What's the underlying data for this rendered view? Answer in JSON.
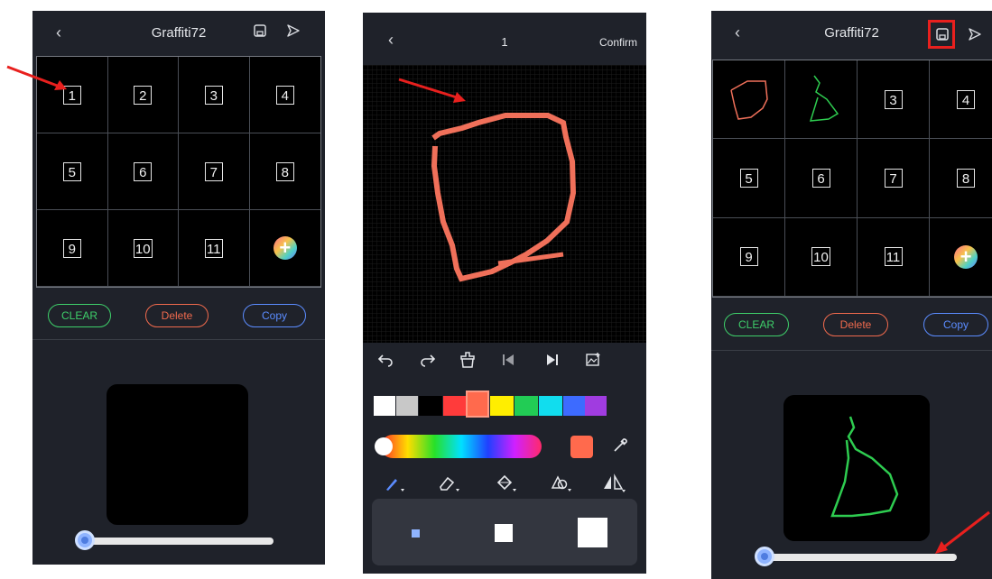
{
  "screens": [
    {
      "title": "Graffiti72",
      "back_icon": "‹",
      "cells": [
        "1",
        "2",
        "3",
        "4",
        "5",
        "6",
        "7",
        "8",
        "9",
        "10",
        "11"
      ],
      "buttons": {
        "clear": "CLEAR",
        "delete": "Delete",
        "copy": "Copy"
      }
    },
    {
      "title": "1",
      "back_icon": "‹",
      "confirm": "Confirm",
      "palette": [
        "#ffffff",
        "#c8c8c8",
        "#000000",
        "#ff3b3b",
        "#ff6a4d",
        "#ffee00",
        "#22cc55",
        "#11ddee",
        "#3d6bff",
        "#a03ce0"
      ],
      "current_color": "#ff6a4d",
      "brush_sizes": [
        "small",
        "medium",
        "large"
      ]
    },
    {
      "title": "Graffiti72",
      "back_icon": "‹",
      "cells": [
        "",
        "",
        "3",
        "4",
        "5",
        "6",
        "7",
        "8",
        "9",
        "10",
        "11"
      ],
      "buttons": {
        "clear": "CLEAR",
        "delete": "Delete",
        "copy": "Copy"
      }
    }
  ],
  "colors": {
    "clear": "#3ecf6a",
    "delete": "#f06a4d",
    "copy": "#5b8cff",
    "drawing_red": "#f0705a",
    "drawing_green": "#2ecc50",
    "annotation": "#e8201e"
  },
  "icons": [
    "back-icon",
    "save-icon",
    "send-icon",
    "undo-icon",
    "redo-icon",
    "clear-canvas-icon",
    "prev-frame-icon",
    "next-frame-icon",
    "add-image-icon",
    "eyedropper-icon",
    "brush-icon",
    "eraser-icon",
    "fill-bucket-icon",
    "shape-icon",
    "mirror-icon",
    "speed-icon"
  ]
}
